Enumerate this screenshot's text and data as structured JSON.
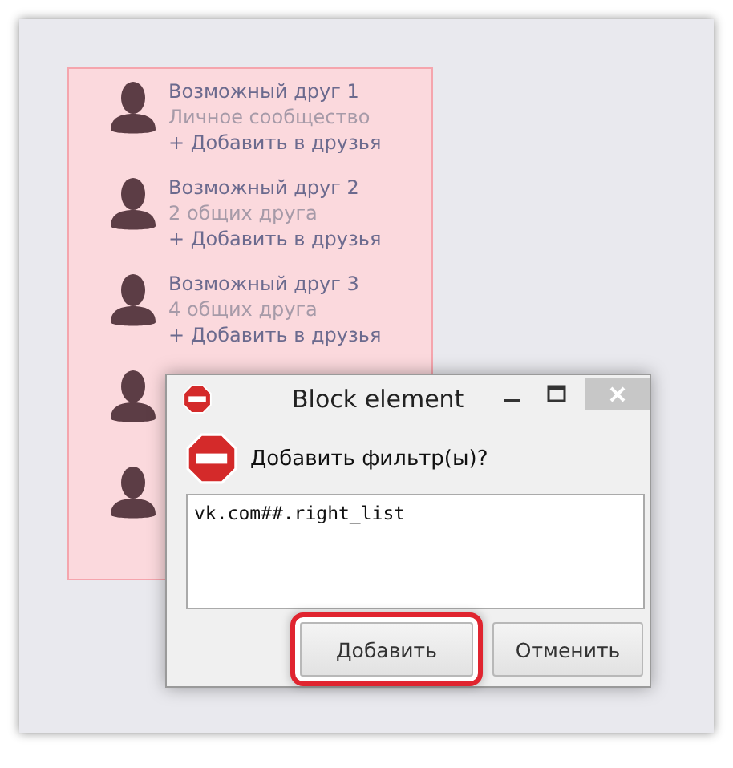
{
  "friends": [
    {
      "kind": "full",
      "name": "Возможный друг 1",
      "info": "Личное сообщество",
      "action": "+ Добавить в друзья"
    },
    {
      "kind": "full",
      "name": "Возможный друг 2",
      "info": "2 общих друга",
      "action": "+ Добавить в друзья"
    },
    {
      "kind": "full",
      "name": "Возможный друг 3",
      "info": "4 общих друга",
      "action": "+ Добавить в друзья"
    },
    {
      "kind": "hidden"
    },
    {
      "kind": "hidden"
    }
  ],
  "dialog": {
    "title": "Block element",
    "question": "Добавить фильтр(ы)?",
    "filter": "vk.com##.right_list",
    "buttons": [
      {
        "label": "Добавить",
        "highlighted": true
      },
      {
        "label": "Отменить",
        "highlighted": false
      }
    ]
  }
}
